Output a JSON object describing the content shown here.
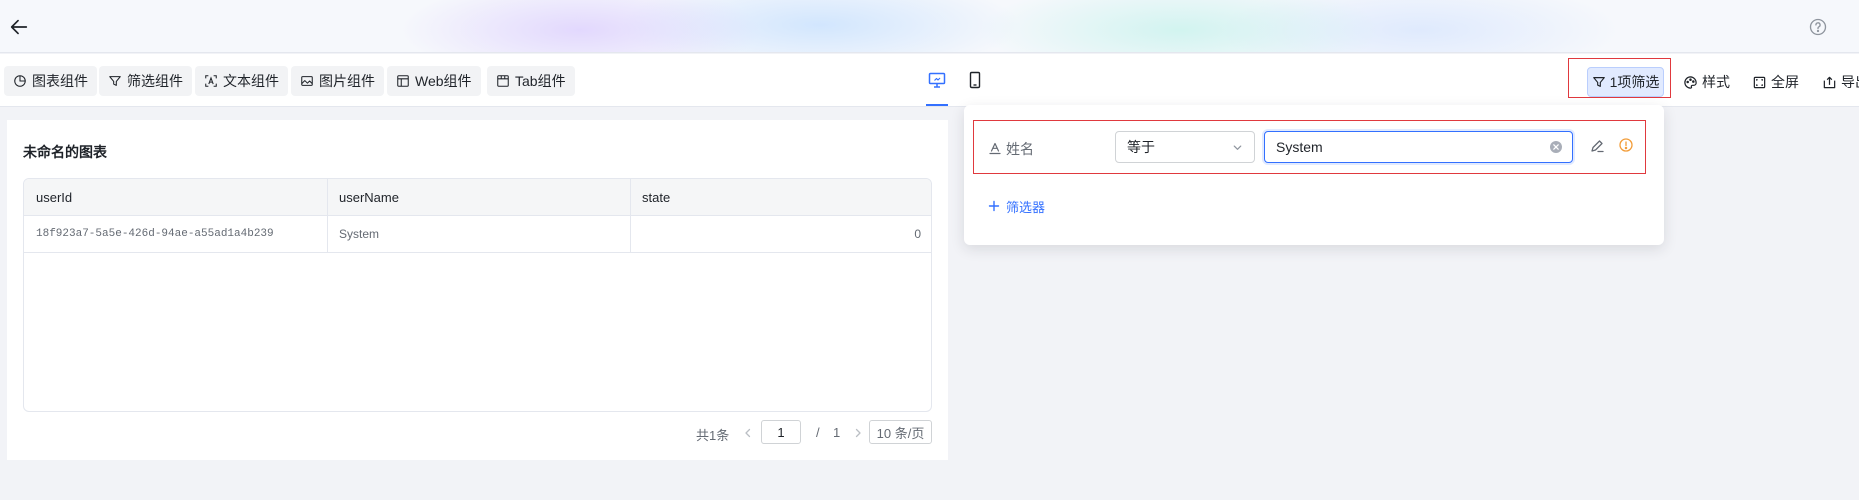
{
  "toolbar": {
    "components": [
      {
        "label": "图表组件",
        "icon": "pie-chart-icon"
      },
      {
        "label": "筛选组件",
        "icon": "funnel-icon"
      },
      {
        "label": "文本组件",
        "icon": "text-icon"
      },
      {
        "label": "图片组件",
        "icon": "image-icon"
      },
      {
        "label": "Web组件",
        "icon": "web-layout-icon"
      },
      {
        "label": "Tab组件",
        "icon": "tab-icon"
      }
    ],
    "filter_button": "1项筛选",
    "style_button": "样式",
    "fullscreen_button": "全屏",
    "export_button": "导出"
  },
  "chart": {
    "title": "未命名的图表",
    "columns": [
      "userId",
      "userName",
      "state"
    ],
    "rows": [
      [
        "18f923a7-5a5e-426d-94ae-a55ad1a4b239",
        "System",
        "0"
      ]
    ],
    "pagination": {
      "total": "共1条",
      "current_page": "1",
      "separator": "/",
      "total_pages": "1",
      "page_size": "10 条/页"
    }
  },
  "filter_panel": {
    "field_label": "姓名",
    "operator": "等于",
    "value": "System",
    "add_filter_label": "筛选器"
  },
  "colors": {
    "accent": "#3370ff",
    "highlight_border": "#e0393e",
    "warning": "#f29c38"
  }
}
